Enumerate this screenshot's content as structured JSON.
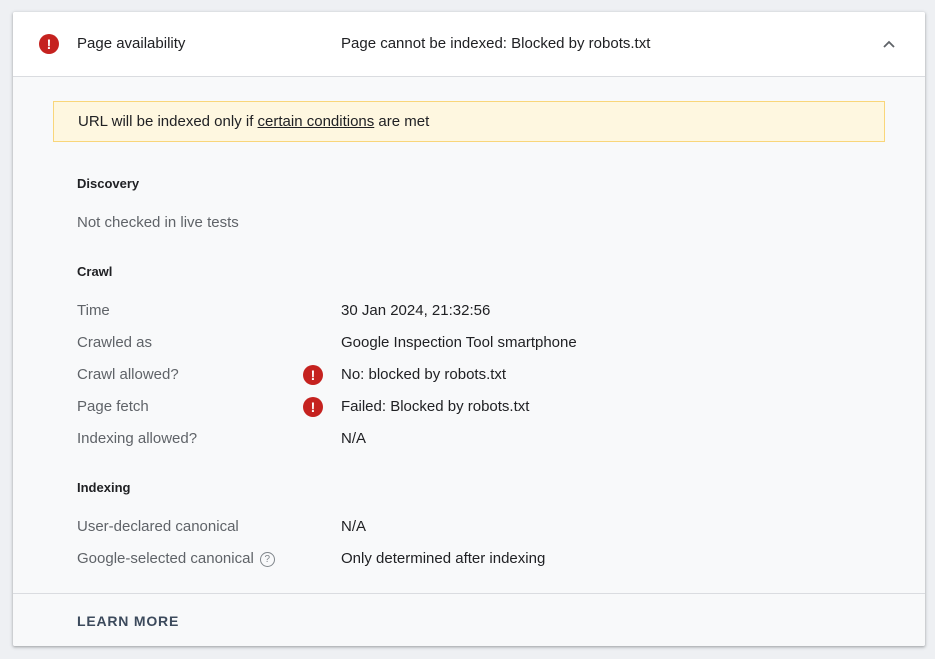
{
  "header": {
    "title": "Page availability",
    "status": "Page cannot be indexed: Blocked by robots.txt",
    "error_icon": "!",
    "error_color": "#c5221f"
  },
  "notice": {
    "prefix": "URL will be indexed only if ",
    "link": "certain conditions",
    "suffix": " are met"
  },
  "discovery": {
    "title": "Discovery",
    "message": "Not checked in live tests"
  },
  "crawl": {
    "title": "Crawl",
    "rows": [
      {
        "label": "Time",
        "value": "30 Jan 2024, 21:32:56"
      },
      {
        "label": "Crawled as",
        "value": "Google Inspection Tool smartphone"
      },
      {
        "label": "Crawl allowed?",
        "value": "No: blocked by robots.txt",
        "icon": "!"
      },
      {
        "label": "Page fetch",
        "value": "Failed: Blocked by robots.txt",
        "icon": "!"
      },
      {
        "label": "Indexing allowed?",
        "value": "N/A"
      }
    ]
  },
  "indexing": {
    "title": "Indexing",
    "rows": [
      {
        "label": "User-declared canonical",
        "value": "N/A"
      },
      {
        "label": "Google-selected canonical",
        "value": "Only determined after indexing",
        "help_icon": "?"
      }
    ]
  },
  "footer": {
    "learn_more": "LEARN MORE"
  }
}
